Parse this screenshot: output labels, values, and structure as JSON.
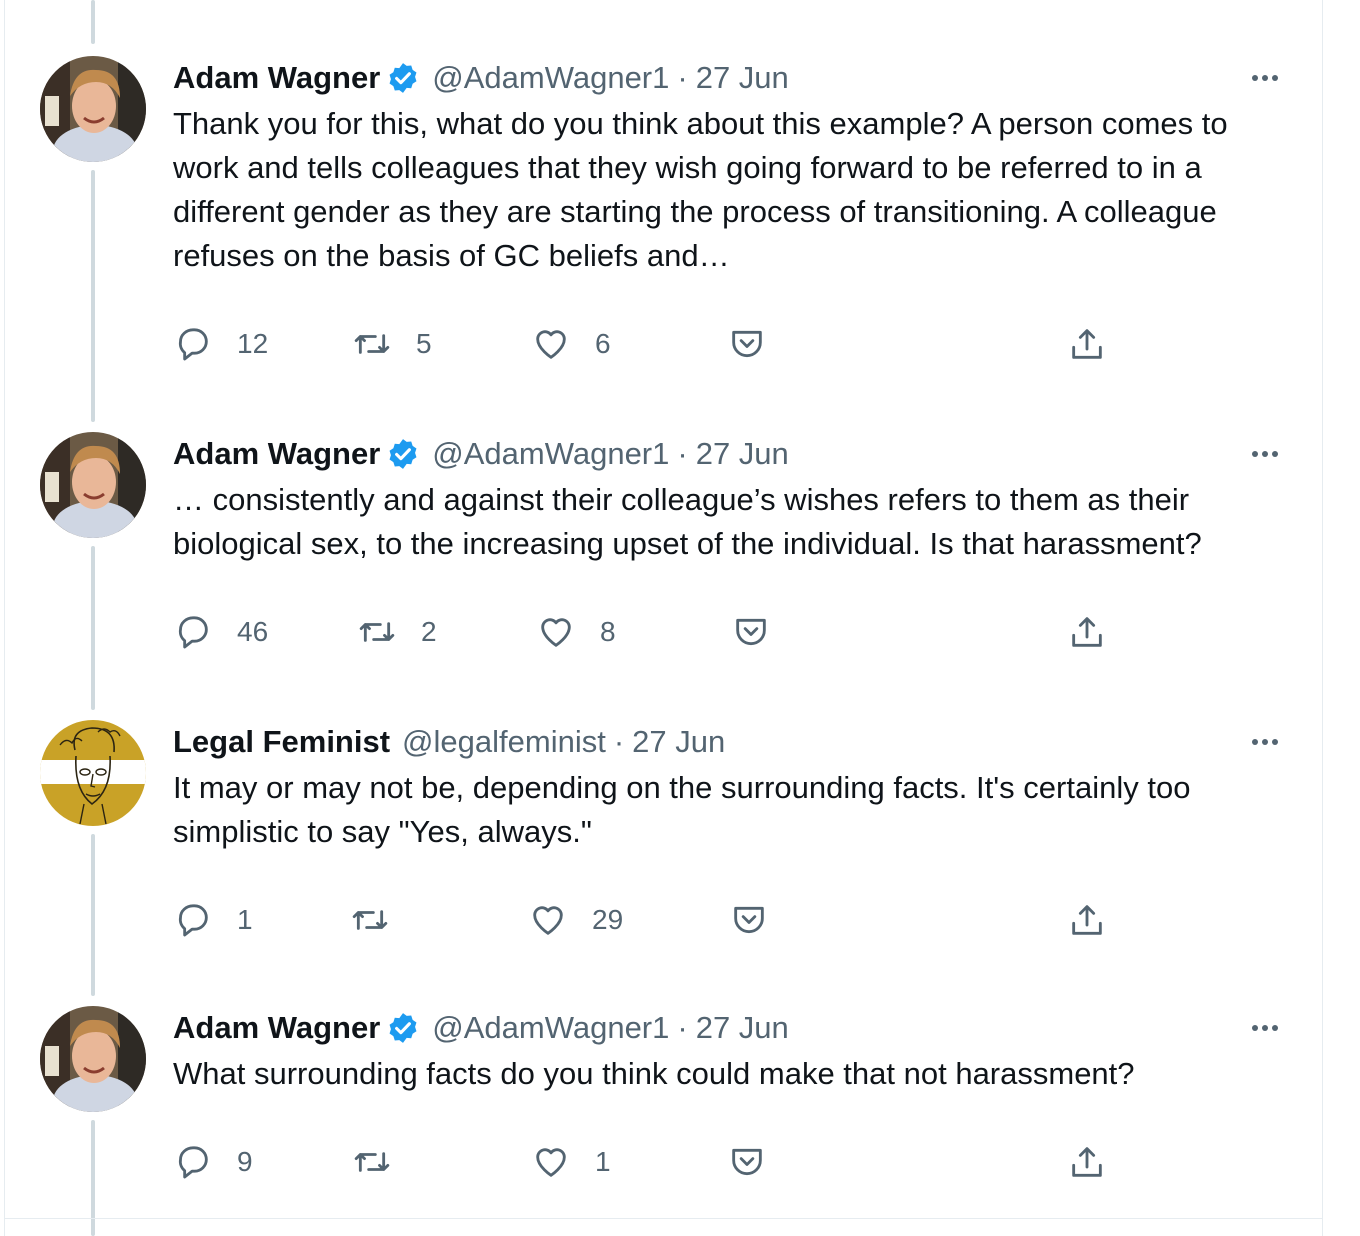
{
  "tweets": [
    {
      "name": "Adam Wagner",
      "verified": true,
      "handle": "@AdamWagner1",
      "separator": "·",
      "date": "27 Jun",
      "text": "Thank you for this, what do you think about this example? A person comes to work and tells colleagues that they wish going forward to be referred to in a different gender as they are starting the process of transitioning. A colleague refuses on the basis of GC beliefs and…",
      "replies": "12",
      "retweets": "5",
      "likes": "6"
    },
    {
      "name": "Adam Wagner",
      "verified": true,
      "handle": "@AdamWagner1",
      "separator": "·",
      "date": "27 Jun",
      "text": "… consistently and against their colleague’s wishes refers to them as their biological sex, to the increasing upset of the individual. Is that harassment?",
      "replies": "46",
      "retweets": "2",
      "likes": "8"
    },
    {
      "name": "Legal Feminist",
      "verified": false,
      "handle": "@legalfeminist",
      "separator": "·",
      "date": "27 Jun",
      "text": "It may or may not be, depending on the surrounding facts. It's certainly too simplistic to say \"Yes, always.\"",
      "replies": "1",
      "retweets": "",
      "likes": "29"
    },
    {
      "name": "Adam Wagner",
      "verified": true,
      "handle": "@AdamWagner1",
      "separator": "·",
      "date": "27 Jun",
      "text": "What surrounding facts do you think could make that not harassment?",
      "replies": "9",
      "retweets": "",
      "likes": "1"
    }
  ],
  "icons": {
    "reply": "speech-bubble-icon",
    "retweet": "retweet-icon",
    "like": "heart-icon",
    "save": "pocket-save-icon",
    "share": "share-upload-icon",
    "more": "more-dots-icon",
    "verified": "verified-badge-icon"
  },
  "colors": {
    "verified_blue": "#1d9bf0",
    "muted_text": "#536471",
    "text": "#0f1419",
    "thread_line": "#cfd9de",
    "legal_feminist_avatar": "#c9a227"
  }
}
